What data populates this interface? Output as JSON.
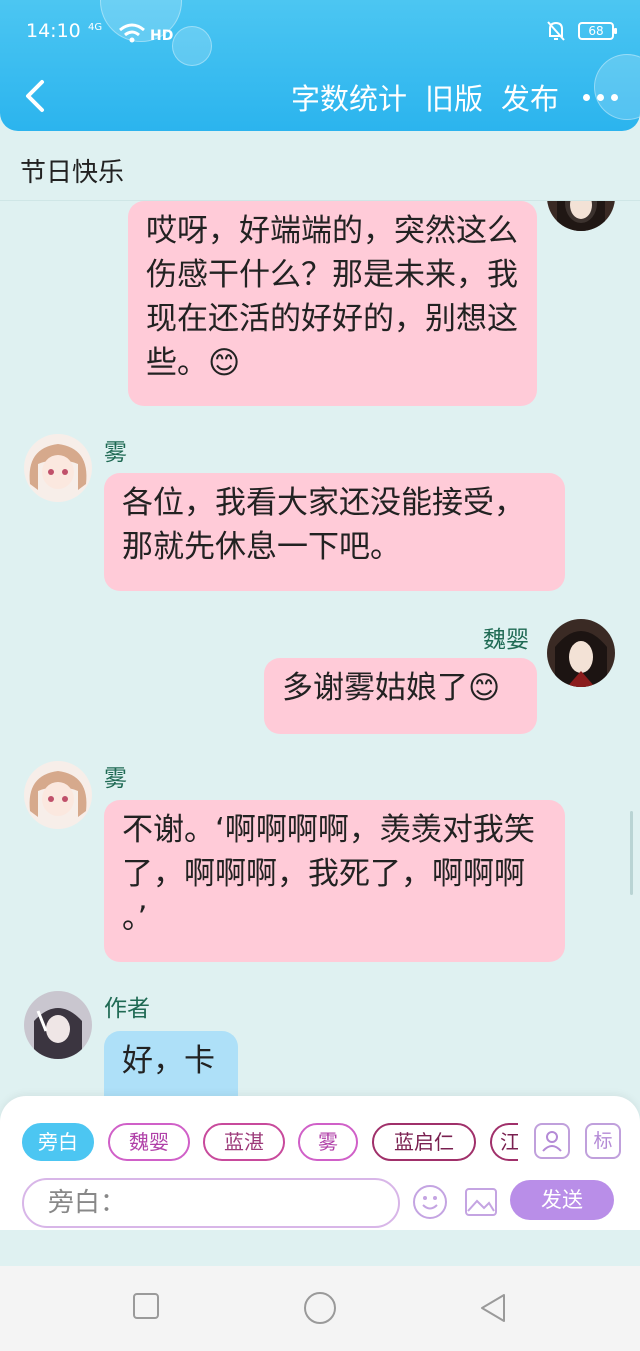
{
  "status_bar": {
    "time": "14:10",
    "network": "4G",
    "wifi_label": "HD",
    "battery": "68"
  },
  "header": {
    "actions": [
      "字数统计",
      "旧版",
      "发布"
    ]
  },
  "page": {
    "title": "节日快乐"
  },
  "messages": [
    {
      "speaker": "",
      "side": "right",
      "text": "哎呀，好端端的，突然这么伤感干什么？那是未来，我现在还活的好好的，别想这些。😊"
    },
    {
      "speaker": "雾",
      "side": "left",
      "text": "各位，我看大家还没能接受，那就先休息一下吧。"
    },
    {
      "speaker": "魏婴",
      "side": "right",
      "text": "多谢雾姑娘了😊"
    },
    {
      "speaker": "雾",
      "side": "left",
      "text": "不谢。‘啊啊啊啊，羡羡对我笑了，啊啊啊，我死了，啊啊啊 。’"
    },
    {
      "speaker": "作者",
      "side": "left",
      "text": "好，卡"
    }
  ],
  "role_chips": [
    "旁白",
    "魏婴",
    "蓝湛",
    "雾",
    "蓝启仁",
    "江"
  ],
  "right_tools": [
    "person-icon",
    "标"
  ],
  "input": {
    "placeholder": "旁白："
  },
  "send": {
    "label": "发送"
  },
  "colors": {
    "header": "#2bb4ee",
    "bubble_pink": "#ffcbd8",
    "bubble_blue": "#aee0f8",
    "send": "#b98ee8"
  }
}
